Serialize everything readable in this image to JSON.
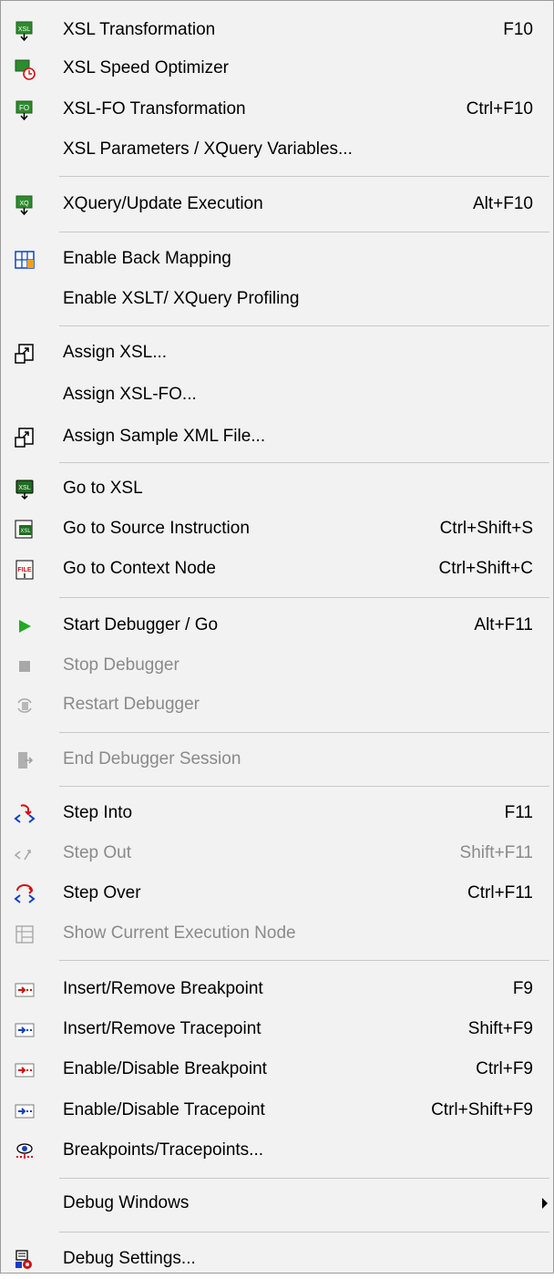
{
  "menu": {
    "items": [
      {
        "label": "XSL Transformation",
        "shortcut": "F10",
        "icon": "xsl-transform-icon",
        "enabled": true
      },
      {
        "label": "XSL Speed Optimizer",
        "shortcut": "",
        "icon": "xsl-speed-optimizer-icon",
        "enabled": true
      },
      {
        "label": "XSL-FO Transformation",
        "shortcut": "Ctrl+F10",
        "icon": "xsl-fo-transform-icon",
        "enabled": true
      },
      {
        "label": "XSL Parameters / XQuery Variables...",
        "shortcut": "",
        "icon": "",
        "enabled": true
      },
      {
        "label": "XQuery/Update Execution",
        "shortcut": "Alt+F10",
        "icon": "xquery-execution-icon",
        "enabled": true
      },
      {
        "label": "Enable Back Mapping",
        "shortcut": "",
        "icon": "back-mapping-icon",
        "enabled": true
      },
      {
        "label": "Enable XSLT/ XQuery Profiling",
        "shortcut": "",
        "icon": "",
        "enabled": true
      },
      {
        "label": "Assign XSL...",
        "shortcut": "",
        "icon": "assign-icon",
        "enabled": true
      },
      {
        "label": "Assign XSL-FO...",
        "shortcut": "",
        "icon": "",
        "enabled": true
      },
      {
        "label": "Assign Sample XML File...",
        "shortcut": "",
        "icon": "assign-icon",
        "enabled": true
      },
      {
        "label": "Go to XSL",
        "shortcut": "",
        "icon": "go-to-xsl-icon",
        "enabled": true
      },
      {
        "label": "Go to Source Instruction",
        "shortcut": "Ctrl+Shift+S",
        "icon": "go-to-source-icon",
        "enabled": true
      },
      {
        "label": "Go to Context Node",
        "shortcut": "Ctrl+Shift+C",
        "icon": "go-to-context-node-icon",
        "enabled": true
      },
      {
        "label": "Start Debugger / Go",
        "shortcut": "Alt+F11",
        "icon": "play-icon",
        "enabled": true
      },
      {
        "label": "Stop Debugger",
        "shortcut": "",
        "icon": "stop-icon",
        "enabled": false
      },
      {
        "label": "Restart Debugger",
        "shortcut": "",
        "icon": "restart-icon",
        "enabled": false
      },
      {
        "label": "End Debugger Session",
        "shortcut": "",
        "icon": "end-session-icon",
        "enabled": false
      },
      {
        "label": "Step Into",
        "shortcut": "F11",
        "icon": "step-into-icon",
        "enabled": true
      },
      {
        "label": "Step Out",
        "shortcut": "Shift+F11",
        "icon": "step-out-icon",
        "enabled": false
      },
      {
        "label": "Step Over",
        "shortcut": "Ctrl+F11",
        "icon": "step-over-icon",
        "enabled": true
      },
      {
        "label": "Show Current Execution Node",
        "shortcut": "",
        "icon": "current-execution-node-icon",
        "enabled": false
      },
      {
        "label": "Insert/Remove Breakpoint",
        "shortcut": "F9",
        "icon": "breakpoint-icon",
        "enabled": true
      },
      {
        "label": "Insert/Remove Tracepoint",
        "shortcut": "Shift+F9",
        "icon": "tracepoint-icon",
        "enabled": true
      },
      {
        "label": "Enable/Disable Breakpoint",
        "shortcut": "Ctrl+F9",
        "icon": "breakpoint-icon",
        "enabled": true
      },
      {
        "label": "Enable/Disable Tracepoint",
        "shortcut": "Ctrl+Shift+F9",
        "icon": "tracepoint-icon",
        "enabled": true
      },
      {
        "label": "Breakpoints/Tracepoints...",
        "shortcut": "",
        "icon": "breakpoints-dialog-icon",
        "enabled": true
      },
      {
        "label": "Debug Windows",
        "shortcut": "",
        "icon": "",
        "enabled": true,
        "submenu": true
      },
      {
        "label": "Debug Settings...",
        "shortcut": "",
        "icon": "debug-settings-icon",
        "enabled": true
      }
    ]
  },
  "colors": {
    "menu_bg": "#f2f2f2",
    "separator": "#c8c8c8",
    "disabled_text": "#8a8a8a",
    "icon_green": "#2e8b2e",
    "breakpoint_red": "#d01010",
    "tracepoint_blue": "#1040c0"
  }
}
